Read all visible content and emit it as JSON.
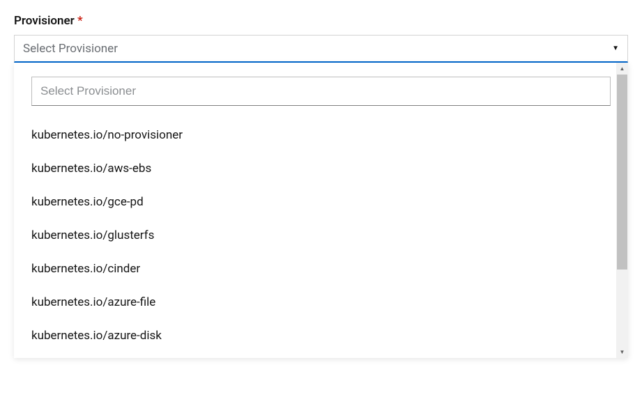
{
  "field": {
    "label": "Provisioner",
    "required_marker": "*"
  },
  "select": {
    "placeholder": "Select Provisioner"
  },
  "filter": {
    "placeholder": "Select Provisioner",
    "value": ""
  },
  "options": [
    "kubernetes.io/no-provisioner",
    "kubernetes.io/aws-ebs",
    "kubernetes.io/gce-pd",
    "kubernetes.io/glusterfs",
    "kubernetes.io/cinder",
    "kubernetes.io/azure-file",
    "kubernetes.io/azure-disk"
  ]
}
